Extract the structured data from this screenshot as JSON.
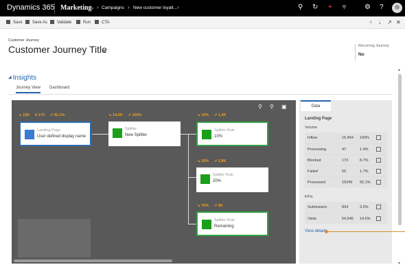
{
  "topbar": {
    "brand": "Dynamics 365",
    "app": "Marketing",
    "breadcrumb": [
      "Campaigns",
      "New customer loyalt..."
    ]
  },
  "commands": [
    "Save",
    "Save As",
    "Validate",
    "Run",
    "CTA"
  ],
  "header": {
    "entity": "Customer Journey",
    "title": "Customer Journey Title",
    "recurring_label": "Recurring Journey",
    "recurring_value": "No"
  },
  "insights": {
    "title": "Insights",
    "tabs": [
      "Journey View",
      "Dashboard"
    ]
  },
  "tiles": [
    {
      "title": "Landing Page",
      "subtitle": "User defined display name",
      "stats": [
        "15K",
        "173",
        "92.1%"
      ],
      "color": "#3a7bd5"
    },
    {
      "title": "Splitter",
      "subtitle": "New Splitter",
      "stats": [
        "14.2K",
        "100%"
      ],
      "color": "#1aa01a"
    },
    {
      "title": "Splitter Rule",
      "subtitle": "10%",
      "stats": [
        "10%",
        "1.4K"
      ],
      "color": "#1aa01a"
    },
    {
      "title": "Splitter Rule",
      "subtitle": "20%",
      "stats": [
        "20%",
        "2.8K"
      ],
      "color": "#1aa01a"
    },
    {
      "title": "Splitter Rule",
      "subtitle": "Remaining",
      "stats": [
        "70%",
        "9K"
      ],
      "color": "#1aa01a"
    }
  ],
  "panel": {
    "tab": "Data",
    "heading": "Landing Page",
    "volume_label": "Volume",
    "volume": [
      {
        "name": "Inflow",
        "count": "15,454",
        "pct": "100%"
      },
      {
        "name": "Processing",
        "count": "47",
        "pct": "1.4%"
      },
      {
        "name": "Blocked",
        "count": "173",
        "pct": "8.7%"
      },
      {
        "name": "Failed",
        "count": "59",
        "pct": "1.7%"
      },
      {
        "name": "Processed",
        "count": "15245",
        "pct": "92.1%"
      }
    ],
    "kpis_label": "KPIs",
    "kpis": [
      {
        "name": "Submission",
        "count": "834",
        "pct": "3.5%"
      },
      {
        "name": "Visits",
        "count": "54,546",
        "pct": "14.6%"
      }
    ],
    "view_details": "View details"
  }
}
